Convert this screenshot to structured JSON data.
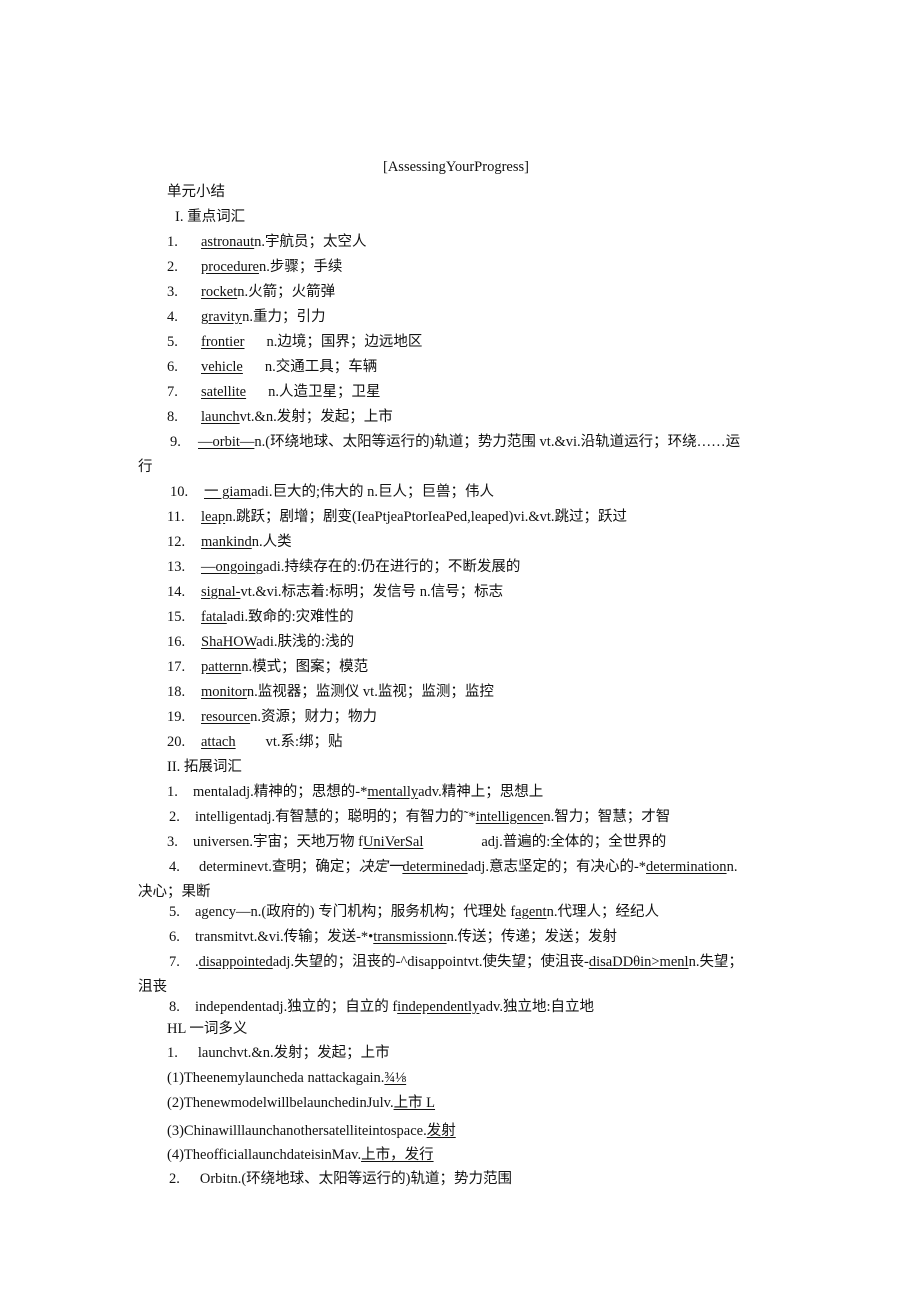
{
  "doc": {
    "title": "[AssessingYourProgress]",
    "unit_summary": "单元小结",
    "section1": {
      "heading": "I. 重点词汇",
      "items": [
        {
          "n": "1.",
          "word": "astronaut",
          "def": "n.宇航员；太空人"
        },
        {
          "n": "2.",
          "word": "procedure",
          "def": "n.步骤；手续"
        },
        {
          "n": "3.",
          "word": "rocket",
          "def": "n.火箭；火箭弹"
        },
        {
          "n": "4.",
          "word": "gravity",
          "def": "n.重力；引力"
        },
        {
          "n": "5.",
          "word": "frontier",
          "def": "n.边境；国界；边远地区"
        },
        {
          "n": "6.",
          "word": "vehicle",
          "def": "n.交通工具；车辆"
        },
        {
          "n": "7.",
          "word": "satellite",
          "def": "n.人造卫星；卫星"
        },
        {
          "n": "8.",
          "word": "launch",
          "def": "vt.&n.发射；发起；上市"
        },
        {
          "n": "9.",
          "word": "—orbit—",
          "def": "n.(环绕地球、太阳等运行的)轨道；势力范围 vt.&vi.沿轨道运行；环绕……运",
          "cont": "行"
        },
        {
          "n": "10.",
          "word": "一 giam",
          "def": "adi.巨大的;伟大的 n.巨人；巨兽；伟人"
        },
        {
          "n": "11.",
          "word": "leap",
          "def": "n.跳跃；剧增；剧变(IeaPtjeaPtorIeaPed,leaped)vi.&vt.跳过；跃过"
        },
        {
          "n": "12.",
          "word": "mankind",
          "def": "n.人类"
        },
        {
          "n": "13.",
          "word": "—ongoing",
          "def": "adi.持续存在的:仍在进行的；不断发展的"
        },
        {
          "n": "14.",
          "word": "signal-",
          "def": "vt.&vi.标志着:标明；发信号 n.信号；标志"
        },
        {
          "n": "15.",
          "word": "fatal",
          "def": "adi.致命的:灾难性的"
        },
        {
          "n": "16.",
          "word": "ShaHOW",
          "def": "adi.肤浅的:浅的"
        },
        {
          "n": "17.",
          "word": "pattern",
          "def": "n.模式；图案；模范"
        },
        {
          "n": "18.",
          "word": "monitor",
          "def": "n.监视器；监测仪 vt.监视；监测；监控"
        },
        {
          "n": "19.",
          "word": "resource",
          "def": "n.资源；财力；物力"
        },
        {
          "n": "20.",
          "word": "attach",
          "def": "vt.系:绑；贴"
        }
      ]
    },
    "section2": {
      "heading": "II. 拓展词汇",
      "items": [
        {
          "n": "1.",
          "a": "mentaladj.精神的；思想的-*",
          "u1": "mentally",
          "b": "adv.精神上；思想上"
        },
        {
          "n": "2.",
          "a": "intelligentadj.有智慧的；聪明的；有智力的˜*",
          "u1": "intelligence",
          "b": "n.智力；智慧；才智"
        },
        {
          "n": "3.",
          "a": "universen.宇宙；天地万物 f",
          "u1": "UniVerSal",
          "b": "adj.普遍的:全体的；全世界的"
        },
        {
          "n": "4.",
          "a": "determinevt.查明；确定；",
          "it": "决定一",
          "u1": "determined",
          "b": "adj.意志坚定的；有决心的-*",
          "u2": "determination",
          "c": "n.",
          "cont": "决心；果断"
        },
        {
          "n": "5.",
          "a": "agency—n.(政府的) 专门机构；服务机构；代理处 f",
          "u1": "agent",
          "b": "n.代理人；经纪人"
        },
        {
          "n": "6.",
          "a": "transmitvt.&vi.传输；发送-*•",
          "u1": "transmission",
          "b": "n.传送；传递；发送；发射"
        },
        {
          "n": "7.",
          "a": ".",
          "u1": "disappointed",
          "b": "adj.失望的；沮丧的-^disappointvt.使失望；使沮丧-",
          "u2": "disaDDθin>menl",
          "c": "n.失望；",
          "cont": "沮丧"
        },
        {
          "n": "8.",
          "a": "independentadj.独立的；自立的 f",
          "u1": "independently",
          "b": "adv.独立地:自立地"
        }
      ]
    },
    "section3": {
      "heading": "HL 一词多义",
      "item1": {
        "n": "1.",
        "text": "launchvt.&n.发射；发起；上市"
      },
      "examples": [
        {
          "sentence": "(1)Theenemylauncheda nattackagain.",
          "answer": "¾⅛"
        },
        {
          "sentence": "(2)ThenewmodelwillbelaunchedinJulv.",
          "answer": "上市 L"
        },
        {
          "sentence": "(3)Chinawilllaunchanothersatelliteintospace.",
          "answer": "发射"
        },
        {
          "sentence": "(4)TheofficiallaunchdateisinMav.",
          "answer": "上市，发行"
        }
      ],
      "item2": {
        "n": "2.",
        "text": "Orbitn.(环绕地球、太阳等运行的)轨道；势力范围"
      }
    }
  }
}
